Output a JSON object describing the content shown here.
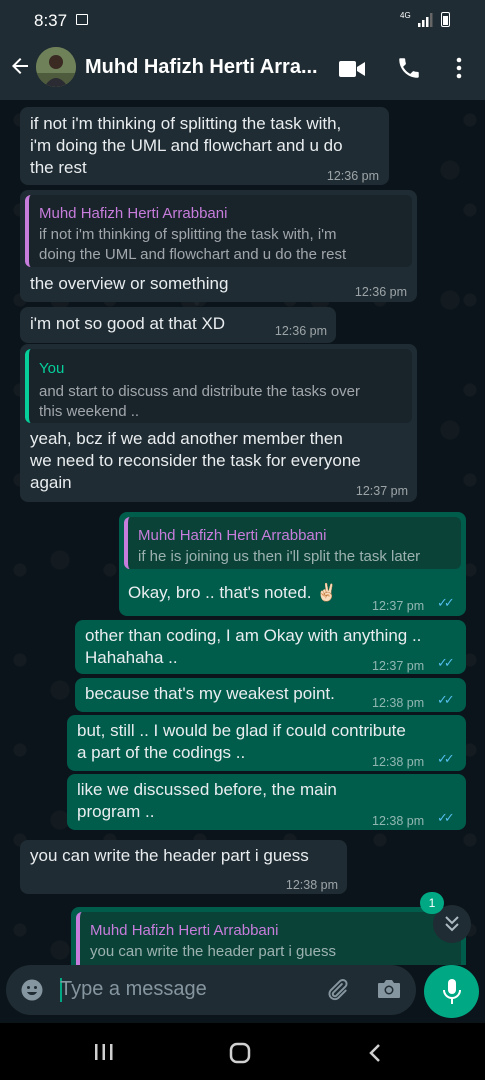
{
  "status_bar": {
    "time": "8:37",
    "network": "4G"
  },
  "header": {
    "contact_name": "Muhd Hafizh Herti Arra..."
  },
  "messages": [
    {
      "lines": [
        "if not i'm thinking of splitting the task with,",
        "i'm doing the UML and flowchart and u do",
        "the rest"
      ],
      "time": "12:36 pm"
    },
    {
      "quote_author": "Muhd Hafizh Herti Arrabbani",
      "quote_lines": [
        "if not i'm thinking of splitting the task with, i'm",
        "doing the UML and flowchart and u do the rest"
      ],
      "lines": [
        "the overview or something"
      ],
      "time": "12:36 pm"
    },
    {
      "lines": [
        "i'm not so good at that  XD"
      ],
      "time": "12:36 pm"
    },
    {
      "quote_author": "You",
      "quote_lines": [
        "and start to discuss and distribute the tasks over",
        "this weekend .."
      ],
      "lines": [
        "yeah, bcz if we add another member then",
        "we need to reconsider the task for everyone",
        "again"
      ],
      "time": "12:37 pm"
    },
    {
      "quote_author": "Muhd Hafizh Herti Arrabbani",
      "quote_lines": [
        "if he is joining us then i'll split the task later"
      ],
      "lines": [
        "Okay, bro .. that's noted. ✌🏻"
      ],
      "time": "12:37 pm"
    },
    {
      "lines": [
        "other than coding, I am Okay with anything ..",
        "Hahahaha .."
      ],
      "time": "12:37 pm"
    },
    {
      "lines": [
        "because that's my weakest point."
      ],
      "time": "12:38 pm"
    },
    {
      "lines": [
        "but, still .. I would be glad if could contribute",
        "a part of the codings .."
      ],
      "time": "12:38 pm"
    },
    {
      "lines": [
        "like we discussed before, the main",
        "program .."
      ],
      "time": "12:38 pm"
    },
    {
      "lines": [
        "you can write the header part i guess"
      ],
      "time": "12:38 pm"
    },
    {
      "quote_author": "Muhd Hafizh Herti Arrabbani",
      "quote_lines": [
        "you can write the header part i guess"
      ]
    }
  ],
  "unread_badge": "1",
  "input": {
    "placeholder": "Type a message"
  },
  "colors": {
    "incoming_bubble": "#1f2c33",
    "outgoing_bubble": "#005c4b",
    "accent": "#00a884",
    "read_ticks": "#53bdeb",
    "quote_author_other": "#c77ddb",
    "quote_author_you": "#06cf9c"
  },
  "icons": [
    "back-arrow-icon",
    "avatar",
    "video-call-icon",
    "phone-icon",
    "more-vert-icon",
    "emoji-icon",
    "attach-icon",
    "camera-icon",
    "mic-icon",
    "double-chevron-down-icon",
    "double-check-icon",
    "nav-recent-icon",
    "nav-home-icon",
    "nav-back-icon"
  ]
}
